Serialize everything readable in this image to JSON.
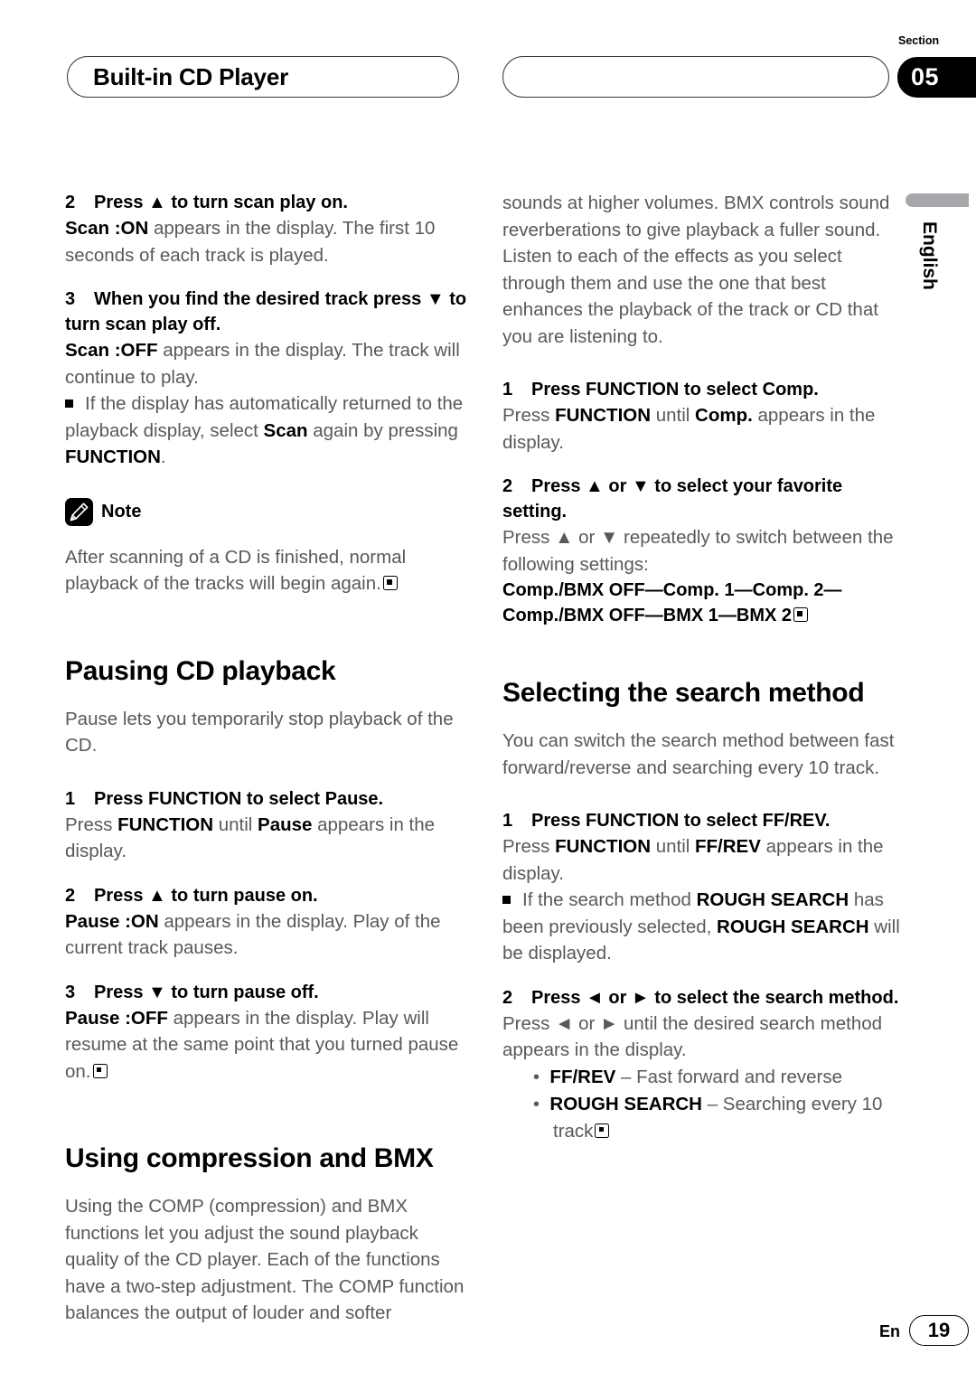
{
  "header": {
    "title": "Built-in CD Player",
    "section_label": "Section",
    "section_number": "05"
  },
  "side_tab": {
    "language": "English"
  },
  "footer": {
    "lang_code": "En",
    "page_number": "19"
  },
  "left_column": {
    "step2_scan_on": {
      "number": "2",
      "text": "Press ▲ to turn scan play on."
    },
    "step2_scan_on_body_bold": "Scan :ON",
    "step2_scan_on_body_rest": " appears in the display. The first 10 seconds of each track is played.",
    "step3_scan_off": {
      "number": "3",
      "text": "When you find the desired track press ▼ to turn scan play off."
    },
    "step3_scan_off_body_bold": "Scan :OFF",
    "step3_scan_off_body_rest": " appears in the display. The track will continue to play.",
    "bullet_scan_p1": "If the display has automatically returned to the playback display, select ",
    "bullet_scan_b1": "Scan",
    "bullet_scan_p2": " again by pressing ",
    "bullet_scan_b2": "FUNCTION",
    "bullet_scan_p3": ".",
    "note_label": "Note",
    "note_body": "After scanning of a CD is finished, normal playback of the tracks will begin again.",
    "h_pausing": "Pausing CD playback",
    "pausing_intro": "Pause lets you temporarily stop playback of the CD.",
    "step1_pause": {
      "number": "1",
      "text": "Press FUNCTION to select Pause."
    },
    "step1_pause_p1": "Press ",
    "step1_pause_b1": "FUNCTION",
    "step1_pause_p2": " until ",
    "step1_pause_b2": "Pause",
    "step1_pause_p3": " appears in the display.",
    "step2_pause": {
      "number": "2",
      "text": "Press ▲ to turn pause on."
    },
    "step2_pause_body_bold": "Pause :ON",
    "step2_pause_body_rest": " appears in the display. Play of the current track pauses.",
    "step3_pause": {
      "number": "3",
      "text": "Press ▼ to turn pause off."
    },
    "step3_pause_body_bold": "Pause :OFF",
    "step3_pause_body_rest": " appears in the display. Play will resume at the same point that you turned pause on.",
    "h_compression": "Using compression and BMX",
    "compression_intro": "Using the COMP (compression) and BMX functions let you adjust the sound playback quality of the CD player. Each of the functions have a two-step adjustment. The COMP function balances the output of louder and softer"
  },
  "right_column": {
    "compression_intro_cont": "sounds at higher volumes. BMX controls sound reverberations to give playback a fuller sound. Listen to each of the effects as you select through them and use the one that best enhances the playback of the track or CD that you are listening to.",
    "step1_comp": {
      "number": "1",
      "text": "Press FUNCTION to select Comp."
    },
    "step1_comp_p1": "Press ",
    "step1_comp_b1": "FUNCTION",
    "step1_comp_p2": " until ",
    "step1_comp_b2": "Comp.",
    "step1_comp_p3": " appears in the display.",
    "step2_comp": {
      "number": "2",
      "text": "Press ▲ or ▼ to select your favorite setting."
    },
    "step2_comp_body": "Press ▲ or ▼ repeatedly to switch between the following settings:",
    "settings_line1": "Comp./BMX OFF—Comp. 1—Comp. 2—",
    "settings_line2": "Comp./BMX OFF—BMX 1—BMX 2",
    "h_search": "Selecting the search method",
    "search_intro": "You can switch the search method between fast forward/reverse and searching every 10 track.",
    "step1_ffrev": {
      "number": "1",
      "text": "Press FUNCTION to select FF/REV."
    },
    "step1_ffrev_p1": "Press ",
    "step1_ffrev_b1": "FUNCTION",
    "step1_ffrev_p2": " until ",
    "step1_ffrev_b2": "FF/REV",
    "step1_ffrev_p3": " appears in the display.",
    "bullet_rough_p1": "If the search method ",
    "bullet_rough_b1": "ROUGH SEARCH",
    "bullet_rough_p2": " has been previously selected, ",
    "bullet_rough_b2": "ROUGH SEARCH",
    "bullet_rough_p3": " will be displayed.",
    "step2_ffrev": {
      "number": "2",
      "text": "Press ◄ or ► to select the search method."
    },
    "step2_ffrev_body": "Press ◄ or ► until the desired search method appears in the display.",
    "list": [
      {
        "bold": "FF/REV",
        "rest": " – Fast forward and reverse"
      },
      {
        "bold": "ROUGH SEARCH",
        "rest": " – Searching every 10 track"
      }
    ]
  }
}
